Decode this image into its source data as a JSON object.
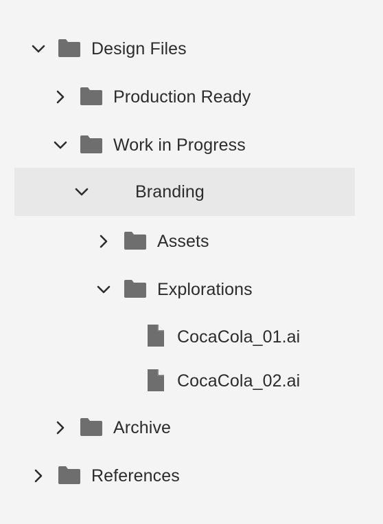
{
  "tree": {
    "items": [
      {
        "label": "Design Files",
        "type": "folder",
        "expanded": true,
        "icon": "folder-icon"
      },
      {
        "label": "Production Ready",
        "type": "folder",
        "expanded": false,
        "icon": "folder-icon"
      },
      {
        "label": "Work in Progress",
        "type": "folder",
        "expanded": true,
        "icon": "folder-icon"
      },
      {
        "label": "Branding",
        "type": "folder",
        "expanded": true,
        "selected": true
      },
      {
        "label": "Assets",
        "type": "folder",
        "expanded": false,
        "icon": "folder-icon"
      },
      {
        "label": "Explorations",
        "type": "folder",
        "expanded": true,
        "icon": "folder-icon"
      },
      {
        "label": "CocaCola_01.ai",
        "type": "file",
        "icon": "file-icon"
      },
      {
        "label": "CocaCola_02.ai",
        "type": "file",
        "icon": "file-icon"
      },
      {
        "label": "Archive",
        "type": "folder",
        "expanded": false,
        "icon": "folder-icon"
      },
      {
        "label": "References",
        "type": "folder",
        "expanded": false,
        "icon": "folder-icon"
      }
    ]
  },
  "colors": {
    "background": "#f4f4f4",
    "selected_row": "#e8e8e8",
    "icon": "#6e6e6e",
    "text": "#2c2c2c"
  }
}
